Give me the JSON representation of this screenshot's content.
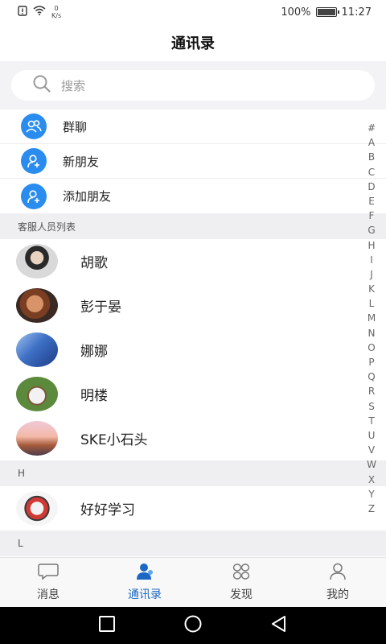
{
  "status_bar": {
    "speed_value": "0",
    "speed_unit": "K/s",
    "battery": "100%",
    "time": "11:27"
  },
  "header": {
    "title": "通讯录"
  },
  "search": {
    "placeholder": "搜索"
  },
  "functions": [
    {
      "label": "群聊",
      "icon": "group-icon"
    },
    {
      "label": "新朋友",
      "icon": "add-user-icon"
    },
    {
      "label": "添加朋友",
      "icon": "add-user-icon"
    }
  ],
  "sections": [
    {
      "title": "客服人员列表",
      "contacts": [
        {
          "name": "胡歌"
        },
        {
          "name": "彭于晏"
        },
        {
          "name": "娜娜"
        },
        {
          "name": "明楼"
        },
        {
          "name": "SKE小石头"
        }
      ]
    },
    {
      "title": "H",
      "contacts": [
        {
          "name": "好好学习"
        }
      ]
    },
    {
      "title": "L",
      "contacts": []
    }
  ],
  "index_letters": [
    "#",
    "A",
    "B",
    "C",
    "D",
    "E",
    "F",
    "G",
    "H",
    "I",
    "J",
    "K",
    "L",
    "M",
    "N",
    "O",
    "P",
    "Q",
    "R",
    "S",
    "T",
    "U",
    "V",
    "W",
    "X",
    "Y",
    "Z"
  ],
  "bottom_nav": [
    {
      "label": "消息",
      "icon": "message-icon",
      "active": false
    },
    {
      "label": "通讯录",
      "icon": "contacts-icon",
      "active": true
    },
    {
      "label": "发现",
      "icon": "discover-icon",
      "active": false
    },
    {
      "label": "我的",
      "icon": "profile-icon",
      "active": false
    }
  ],
  "colors": {
    "accent": "#2b8cf0",
    "nav_active": "#1c67c4",
    "section_bg": "#efeff1"
  }
}
